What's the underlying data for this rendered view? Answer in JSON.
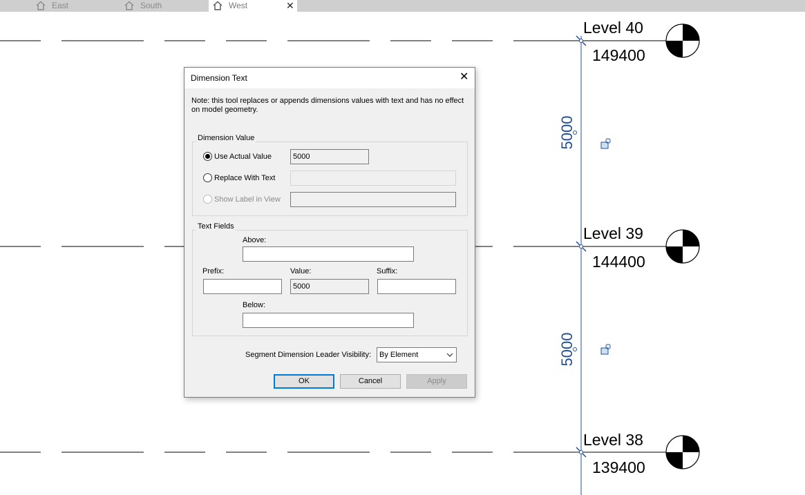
{
  "tabs": [
    {
      "label": "East",
      "icon": "home-icon"
    },
    {
      "label": "South",
      "icon": "home-icon"
    },
    {
      "label": "West",
      "icon": "home-icon",
      "active": true
    }
  ],
  "view": {
    "levels": [
      {
        "name": "Level 40",
        "elevation": "149400"
      },
      {
        "name": "Level 39",
        "elevation": "144400"
      },
      {
        "name": "Level 38",
        "elevation": "139400"
      }
    ],
    "dimensions": [
      "5000",
      "5000"
    ],
    "line_color": "#1f4f9a"
  },
  "dialog": {
    "title": "Dimension Text",
    "note": "Note: this tool replaces or appends dimensions values with text and has no effect on model geometry.",
    "dimension_value": {
      "group_label": "Dimension Value",
      "use_actual": {
        "label": "Use Actual Value",
        "checked": true,
        "value": "5000"
      },
      "replace_with_text": {
        "label": "Replace With Text",
        "value": ""
      },
      "show_label": {
        "label": "Show Label in View",
        "value": ""
      }
    },
    "text_fields": {
      "group_label": "Text Fields",
      "above_label": "Above:",
      "prefix_label": "Prefix:",
      "value_label": "Value:",
      "value": "5000",
      "suffix_label": "Suffix:",
      "below_label": "Below:"
    },
    "segment_visibility": {
      "label": "Segment Dimension Leader Visibility:",
      "selected": "By Element"
    },
    "buttons": {
      "ok": "OK",
      "cancel": "Cancel",
      "apply": "Apply"
    }
  }
}
